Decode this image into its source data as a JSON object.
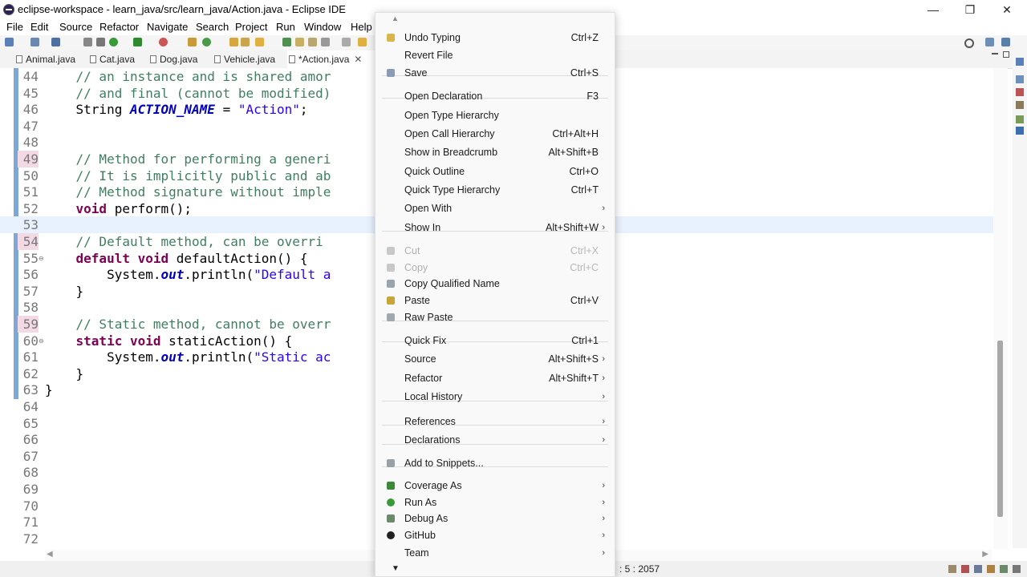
{
  "window": {
    "title": "eclipse-workspace - learn_java/src/learn_java/Action.java - Eclipse IDE",
    "minimize": "—",
    "maximize": "❐",
    "close": "✕"
  },
  "menubar": [
    "File",
    "Edit",
    "Source",
    "Refactor",
    "Navigate",
    "Search",
    "Project",
    "Run",
    "Window",
    "Help"
  ],
  "tabs": [
    {
      "label": "Animal.java"
    },
    {
      "label": "Cat.java"
    },
    {
      "label": "Dog.java"
    },
    {
      "label": "Vehicle.java"
    },
    {
      "label": "*Action.java",
      "close": "✕"
    }
  ],
  "editor": {
    "lines": [
      {
        "num": "44",
        "code": "    // an instance and is shared amor"
      },
      {
        "num": "45",
        "code": "    // and final (cannot be modified)"
      },
      {
        "num": "46",
        "code": "    String ACTION_NAME = \"Action\";"
      },
      {
        "num": "47",
        "code": ""
      },
      {
        "num": "48",
        "code": ""
      },
      {
        "num": "49",
        "code": "    // Method for performing a generi"
      },
      {
        "num": "50",
        "code": "    // It is implicitly public and ab"
      },
      {
        "num": "51",
        "code": "    // Method signature without imple"
      },
      {
        "num": "52",
        "code": "    void perform();"
      },
      {
        "num": "53",
        "code": ""
      },
      {
        "num": "54",
        "code": "    // Default method, can be overri"
      },
      {
        "num": "55",
        "code": "    default void defaultAction() {"
      },
      {
        "num": "56",
        "code": "        System.out.println(\"Default a"
      },
      {
        "num": "57",
        "code": "    }"
      },
      {
        "num": "58",
        "code": ""
      },
      {
        "num": "59",
        "code": "    // Static method, cannot be overr"
      },
      {
        "num": "60",
        "code": "    static void staticAction() {"
      },
      {
        "num": "61",
        "code": "        System.out.println(\"Static ac"
      },
      {
        "num": "62",
        "code": "    }"
      },
      {
        "num": "63",
        "code": "}"
      },
      {
        "num": "64",
        "code": ""
      },
      {
        "num": "65",
        "code": ""
      },
      {
        "num": "66",
        "code": ""
      },
      {
        "num": "67",
        "code": ""
      },
      {
        "num": "68",
        "code": ""
      },
      {
        "num": "69",
        "code": ""
      },
      {
        "num": "70",
        "code": ""
      },
      {
        "num": "71",
        "code": ""
      },
      {
        "num": "72",
        "code": ""
      }
    ]
  },
  "context_menu": {
    "items": [
      {
        "label": "Undo Typing",
        "accel": "Ctrl+Z",
        "icon": "undo-icon"
      },
      {
        "label": "Revert File",
        "accel": ""
      },
      {
        "label": "Save",
        "accel": "Ctrl+S",
        "icon": "save-icon"
      },
      {
        "label": "Open Declaration",
        "accel": "F3"
      },
      {
        "label": "Open Type Hierarchy",
        "accel": ""
      },
      {
        "label": "Open Call Hierarchy",
        "accel": "Ctrl+Alt+H"
      },
      {
        "label": "Show in Breadcrumb",
        "accel": "Alt+Shift+B"
      },
      {
        "label": "Quick Outline",
        "accel": "Ctrl+O"
      },
      {
        "label": "Quick Type Hierarchy",
        "accel": "Ctrl+T"
      },
      {
        "label": "Open With",
        "accel": ""
      },
      {
        "label": "Show In",
        "accel": "Alt+Shift+W"
      },
      {
        "label": "Cut",
        "accel": "Ctrl+X",
        "icon": "cut-icon"
      },
      {
        "label": "Copy",
        "accel": "Ctrl+C",
        "icon": "copy-icon"
      },
      {
        "label": "Copy Qualified Name",
        "accel": "",
        "icon": "copy-qualified-icon"
      },
      {
        "label": "Paste",
        "accel": "Ctrl+V",
        "icon": "paste-icon"
      },
      {
        "label": "Raw Paste",
        "accel": "",
        "icon": "raw-paste-icon"
      },
      {
        "label": "Quick Fix",
        "accel": "Ctrl+1"
      },
      {
        "label": "Source",
        "accel": "Alt+Shift+S"
      },
      {
        "label": "Refactor",
        "accel": "Alt+Shift+T"
      },
      {
        "label": "Local History",
        "accel": ""
      },
      {
        "label": "References",
        "accel": ""
      },
      {
        "label": "Declarations",
        "accel": ""
      },
      {
        "label": "Add to Snippets...",
        "accel": "",
        "icon": "snippets-icon"
      },
      {
        "label": "Coverage As",
        "accel": "",
        "icon": "coverage-icon"
      },
      {
        "label": "Run As",
        "accel": "",
        "icon": "run-icon"
      },
      {
        "label": "Debug As",
        "accel": "",
        "icon": "debug-icon"
      },
      {
        "label": "GitHub",
        "accel": "",
        "icon": "github-icon"
      },
      {
        "label": "Team",
        "accel": ""
      }
    ],
    "submenu_arrow": "›",
    "scroll_up": "▲",
    "scroll_down": "▼"
  },
  "status": {
    "position": ": 5 : 2057"
  },
  "colors": {
    "comment": "#3f7f5f",
    "keyword": "#7f0055",
    "string": "#2a00ff",
    "field": "#0000c0",
    "line_highlight": "#e8f2fe"
  }
}
